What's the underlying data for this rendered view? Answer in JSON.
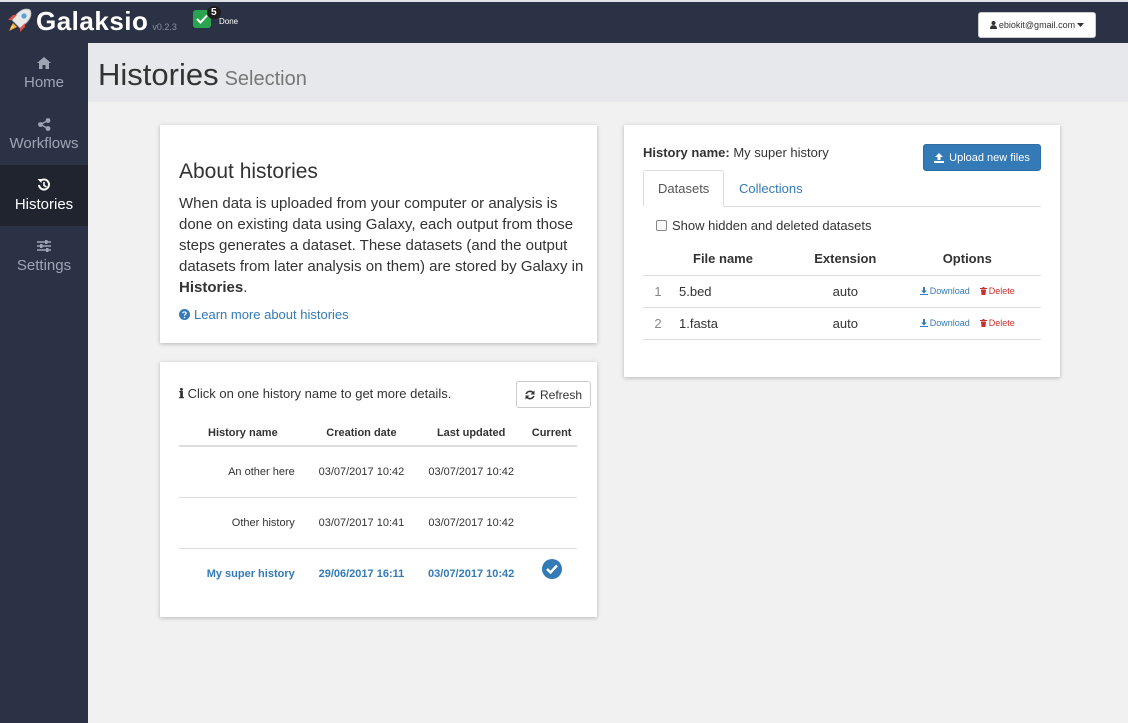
{
  "app": {
    "name": "Galaksio",
    "version": "v0.2.3"
  },
  "jobs": {
    "count": "5",
    "label": "Done"
  },
  "user": {
    "email": "ebiokit@gmail.com"
  },
  "sidebar": {
    "items": [
      {
        "label": "Home",
        "icon": "home-icon"
      },
      {
        "label": "Workflows",
        "icon": "share-icon"
      },
      {
        "label": "Histories",
        "icon": "history-icon",
        "active": true
      },
      {
        "label": "Settings",
        "icon": "sliders-icon"
      }
    ]
  },
  "page": {
    "title": "Histories",
    "subtitle": "Selection"
  },
  "about": {
    "title": "About histories",
    "text_before": "When data is uploaded from your computer or analysis is done on existing data using Galaxy, each output from those steps generates a dataset. These datasets (and the output datasets from later analysis on them) are stored by Galaxy in ",
    "text_bold": "Histories",
    "text_after": ".",
    "link": "Learn more about histories"
  },
  "histories": {
    "info": "Click on one history name to get more details.",
    "refresh_label": "Refresh",
    "columns": [
      "History name",
      "Creation date",
      "Last updated",
      "Current"
    ],
    "rows": [
      {
        "name": "An other here",
        "created": "03/07/2017 10:42",
        "updated": "03/07/2017 10:42",
        "current": false
      },
      {
        "name": "Other history",
        "created": "03/07/2017 10:41",
        "updated": "03/07/2017 10:42",
        "current": false
      },
      {
        "name": "My super history",
        "created": "29/06/2017 16:11",
        "updated": "03/07/2017 10:42",
        "current": true
      }
    ]
  },
  "details": {
    "name_label": "History name:",
    "name_value": "My super history",
    "upload_label": "Upload new files",
    "tabs": [
      "Datasets",
      "Collections"
    ],
    "show_hidden_label": "Show hidden and deleted datasets",
    "columns": [
      "File name",
      "Extension",
      "Options"
    ],
    "download_label": "Download",
    "delete_label": "Delete",
    "rows": [
      {
        "index": "1",
        "file": "5.bed",
        "ext": "auto"
      },
      {
        "index": "2",
        "file": "1.fasta",
        "ext": "auto"
      }
    ]
  },
  "colors": {
    "brand_dark": "#2c3245",
    "accent": "#337ab7",
    "success": "#2aa44f",
    "danger": "#c9302c"
  }
}
